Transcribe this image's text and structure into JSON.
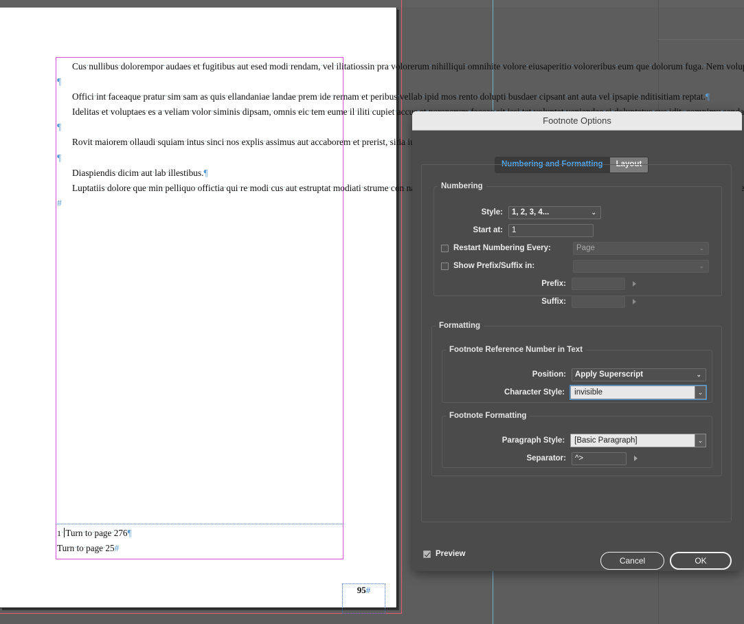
{
  "document": {
    "page_number": "95",
    "page_number_marker": "#",
    "paragraphs": [
      "Cus nullibus dolorempor audaes et fugitibus aut esed modi rendam, vel ilitatiossin pra volorerum nihilliqui omnihite volore eiusaperitio voloreribus eum que dolorum fuga. Nem voluptium que la doluptaque nonet atur?",
      "Offici int faceaque pratur sim sam as quis ellandaniae landae prem ide rernam et peribus vellab ipid mos rento dolupti busdaer cipsant ant auta vel ipsapie nditisitiam reptat.",
      "Idelitas et voluptaes es a veliam volor siminis dipsam, omnis eic tem eume il iliti cupiet accus et poreperum faccae sit issi tet voluptat veniendae si doluptatus cus idit, comnimu sandam eri odictem fuga. Aquamus est, que omni as dolorempor renihiciet quiate volorem. Et quis quatur?",
      "Rovit maiorem ollaudi squiam intus sinci nos explis assimus aut accaborem et prerist, sitia ius acepe velent odipiet fuga. Nam sa que net eos aut etur?",
      "Diaspiendis dicim aut lab illestibus.",
      "Luptatiis dolore que min pelliquo offictia qui re modi cus aut estruptat modiati strume con nam quia erum ute volorat emporpos molutecus, ullabor ehentur sunt remporrum es aut reserit et ressit, sit ut prorumet apiet ditiae andam, officae eaquo tet, cus del ium isquiaturit est, et audignat quiatiur simintur animos de."
    ],
    "footnotes": [
      {
        "number": "1",
        "text": "Turn to page 276"
      },
      {
        "number": "",
        "text": "Turn to page 25"
      }
    ]
  },
  "dialog": {
    "title": "Footnote Options",
    "tabs": [
      {
        "label": "Numbering and Formatting",
        "active": true
      },
      {
        "label": "Layout",
        "active": false
      }
    ],
    "numbering": {
      "legend": "Numbering",
      "style_label": "Style:",
      "style_value": "1, 2, 3, 4...",
      "start_at_label": "Start at:",
      "start_at_value": "1",
      "restart_label": "Restart Numbering Every:",
      "restart_checked": false,
      "restart_value": "Page",
      "show_prefix_suffix_label": "Show Prefix/Suffix in:",
      "show_prefix_suffix_checked": false,
      "show_prefix_suffix_value": "",
      "prefix_label": "Prefix:",
      "prefix_value": "",
      "suffix_label": "Suffix:",
      "suffix_value": ""
    },
    "formatting": {
      "legend": "Formatting",
      "ref_number": {
        "legend": "Footnote Reference Number in Text",
        "position_label": "Position:",
        "position_value": "Apply Superscript",
        "character_style_label": "Character Style:",
        "character_style_value": "invisible"
      },
      "footnote_formatting": {
        "legend": "Footnote Formatting",
        "paragraph_style_label": "Paragraph Style:",
        "paragraph_style_value": "[Basic Paragraph]",
        "separator_label": "Separator:",
        "separator_value": "^>"
      }
    },
    "footer": {
      "preview_label": "Preview",
      "preview_checked": true,
      "cancel_label": "Cancel",
      "ok_label": "OK"
    }
  },
  "colors": {
    "dialog_bg": "#4b4b4b",
    "titlebar_bg": "#e9e9e9",
    "accent_blue": "#4ea6f0",
    "focus_blue": "#3f97e0",
    "bleed_guide": "#f05a6e",
    "margin_guide": "#d94fd9",
    "column_guide": "#73b6d4",
    "workspace_bg": "#5d5d5d"
  }
}
